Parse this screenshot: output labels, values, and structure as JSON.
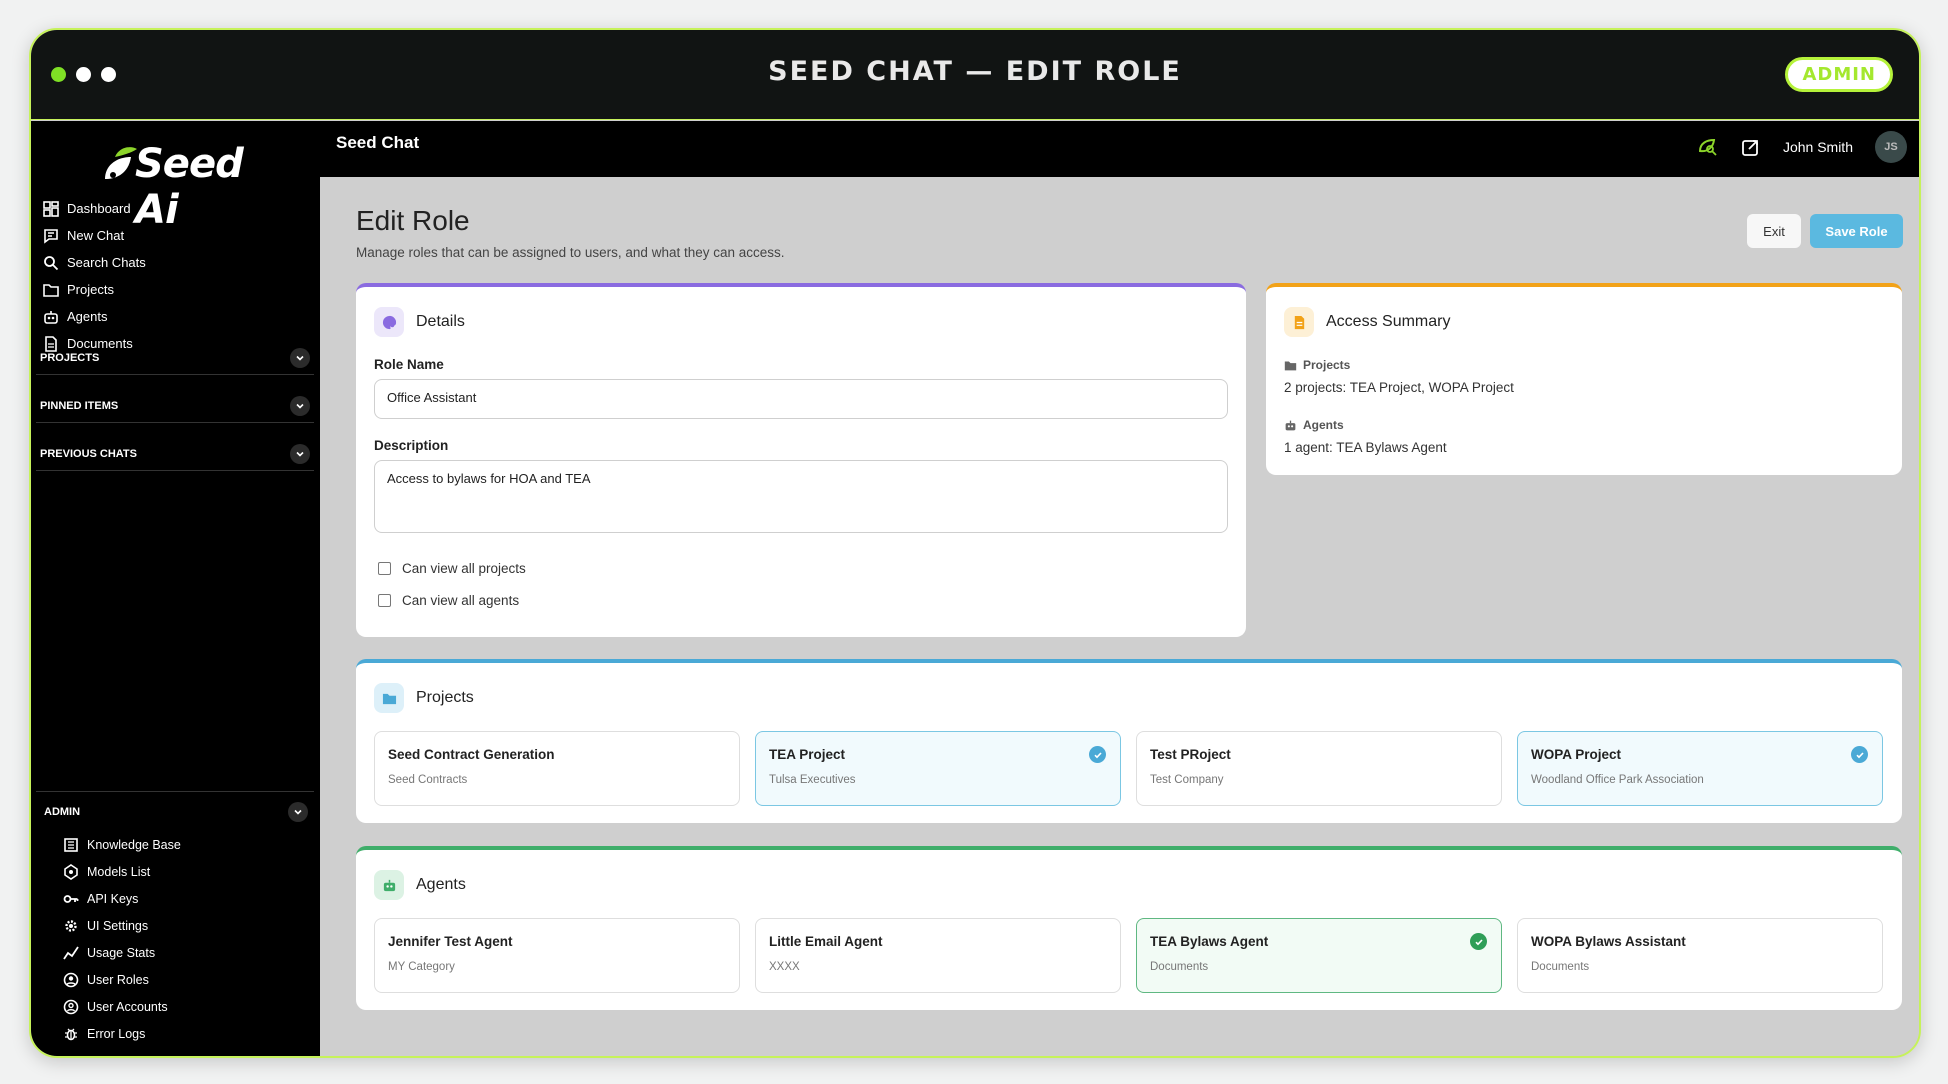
{
  "window": {
    "title": "SEED CHAT  —  EDIT ROLE",
    "badge": "ADMIN"
  },
  "brand": {
    "logo_text": "Seed Ai"
  },
  "sidebar": {
    "nav": [
      {
        "label": "Dashboard",
        "icon": "dashboard-icon"
      },
      {
        "label": "New Chat",
        "icon": "chat-icon"
      },
      {
        "label": "Search Chats",
        "icon": "search-icon"
      },
      {
        "label": "Projects",
        "icon": "folder-icon"
      },
      {
        "label": "Agents",
        "icon": "robot-icon"
      },
      {
        "label": "Documents",
        "icon": "document-icon"
      }
    ],
    "sections": [
      "PROJECTS",
      "PINNED ITEMS",
      "PREVIOUS CHATS"
    ],
    "admin_label": "ADMIN",
    "admin_items": [
      {
        "label": "Knowledge Base",
        "icon": "book-icon"
      },
      {
        "label": "Models List",
        "icon": "model-icon"
      },
      {
        "label": "API Keys",
        "icon": "key-icon"
      },
      {
        "label": "UI Settings",
        "icon": "gear-icon"
      },
      {
        "label": "Usage Stats",
        "icon": "stats-icon"
      },
      {
        "label": "User Roles",
        "icon": "roles-icon"
      },
      {
        "label": "User Accounts",
        "icon": "user-icon"
      },
      {
        "label": "Error Logs",
        "icon": "bug-icon"
      }
    ]
  },
  "topbar": {
    "app_name": "Seed Chat",
    "user_name": "John Smith",
    "user_initials": "JS"
  },
  "page": {
    "title": "Edit Role",
    "subtitle": "Manage roles that can be assigned to users, and what they can access.",
    "exit_label": "Exit",
    "save_label": "Save Role"
  },
  "details": {
    "title": "Details",
    "role_name_label": "Role Name",
    "role_name_value": "Office Assistant",
    "description_label": "Description",
    "description_value": "Access to bylaws for HOA and TEA",
    "check_projects": "Can view all projects",
    "check_agents": "Can view all agents"
  },
  "summary": {
    "title": "Access Summary",
    "projects_label": "Projects",
    "projects_value": "2 projects: TEA Project, WOPA Project",
    "agents_label": "Agents",
    "agents_value": "1 agent: TEA Bylaws Agent"
  },
  "projects": {
    "title": "Projects",
    "items": [
      {
        "name": "Seed Contract Generation",
        "sub": "Seed Contracts",
        "selected": false
      },
      {
        "name": "TEA Project",
        "sub": "Tulsa Executives",
        "selected": true
      },
      {
        "name": "Test PRoject",
        "sub": "Test Company",
        "selected": false
      },
      {
        "name": "WOPA Project",
        "sub": "Woodland Office Park Association",
        "selected": true
      }
    ]
  },
  "agents": {
    "title": "Agents",
    "items": [
      {
        "name": "Jennifer Test Agent",
        "sub": "MY Category",
        "selected": false
      },
      {
        "name": "Little Email Agent",
        "sub": "XXXX",
        "selected": false
      },
      {
        "name": "TEA Bylaws Agent",
        "sub": "Documents",
        "selected": true
      },
      {
        "name": "WOPA Bylaws Assistant",
        "sub": "Documents",
        "selected": false
      }
    ]
  },
  "colors": {
    "accent_lime": "#c6f25a",
    "save_blue": "#5bb9e0",
    "details_purple": "#8a6be0",
    "summary_orange": "#f2a218",
    "projects_blue": "#4aa9d6",
    "agents_green": "#3fae6a"
  }
}
